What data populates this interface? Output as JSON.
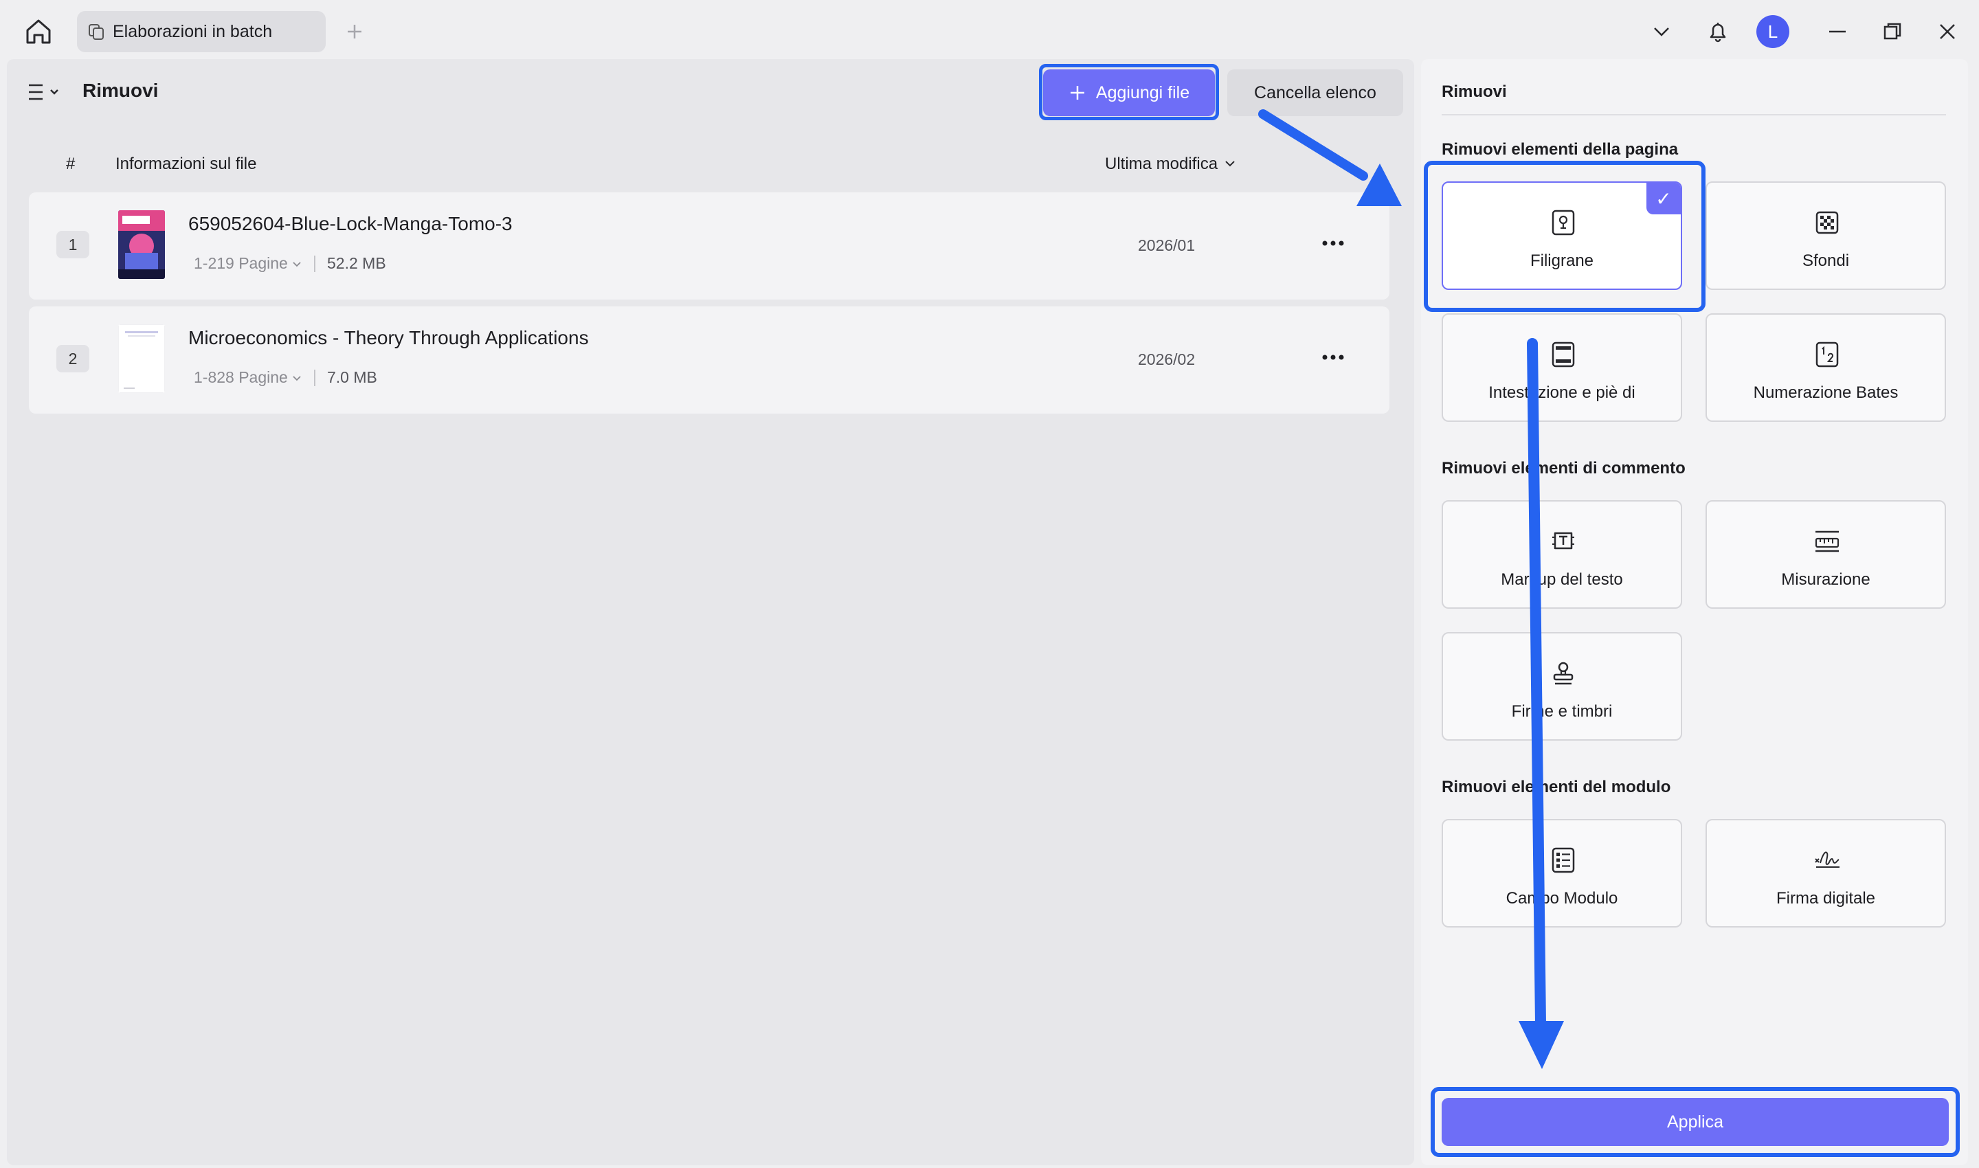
{
  "titlebar": {
    "tab_label": "Elaborazioni in batch",
    "avatar_letter": "L"
  },
  "left": {
    "title": "Rimuovi",
    "add_button": "Aggiungi file",
    "clear_button": "Cancella elenco",
    "columns": {
      "index": "#",
      "info": "Informazioni sul file",
      "modified": "Ultima modifica"
    },
    "files": [
      {
        "index": "1",
        "name": "659052604-Blue-Lock-Manga-Tomo-3",
        "pages": "1-219 Pagine",
        "size": "52.2 MB",
        "date": "2026/01"
      },
      {
        "index": "2",
        "name": "Microeconomics - Theory Through Applications",
        "pages": "1-828 Pagine",
        "size": "7.0 MB",
        "date": "2026/02"
      }
    ]
  },
  "right": {
    "title": "Rimuovi",
    "section_page": "Rimuovi elementi della pagina",
    "section_comment": "Rimuovi elementi di commento",
    "section_form": "Rimuovi elementi del modulo",
    "options": {
      "watermarks": {
        "label": "Filigrane",
        "selected": true,
        "icon": "watermark-icon"
      },
      "backgrounds": {
        "label": "Sfondi",
        "selected": false,
        "icon": "background-icon"
      },
      "header_footer": {
        "label": "Intestazione e piè di",
        "selected": false,
        "icon": "header-footer-icon"
      },
      "bates": {
        "label": "Numerazione Bates",
        "selected": false,
        "icon": "bates-icon"
      },
      "text_markup": {
        "label": "Markup del testo",
        "selected": false,
        "icon": "text-markup-icon"
      },
      "measurement": {
        "label": "Misurazione",
        "selected": false,
        "icon": "ruler-icon"
      },
      "signatures_stamps": {
        "label": "Firme e timbri",
        "selected": false,
        "icon": "stamp-icon"
      },
      "form_field": {
        "label": "Campo Modulo",
        "selected": false,
        "icon": "form-field-icon"
      },
      "digital_signature": {
        "label": "Firma digitale",
        "selected": false,
        "icon": "digital-signature-icon"
      }
    },
    "apply_button": "Applica"
  },
  "colors": {
    "accent": "#6e6ef7",
    "highlight": "#2563f0",
    "avatar": "#4c5cf2"
  }
}
